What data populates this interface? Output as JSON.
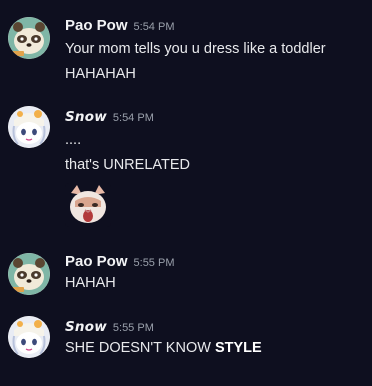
{
  "messages": [
    {
      "author": "Pao Pow",
      "time": "5:54 PM",
      "avatar": "raccoon-avatar-icon",
      "lines": [
        "Your mom tells you u dress like a toddler",
        "HAHAHAH"
      ]
    },
    {
      "author": "Snow",
      "time": "5:54 PM",
      "avatar": "snow-character-avatar-icon",
      "lines": [
        "....",
        "that's UNRELATED"
      ],
      "sticker": "shocked-cat-sticker"
    },
    {
      "author": "Pao Pow",
      "time": "5:55 PM",
      "avatar": "raccoon-avatar-icon",
      "lines": [
        "HAHAH"
      ]
    },
    {
      "author": "Snow",
      "time": "5:55 PM",
      "avatar": "snow-character-avatar-icon",
      "text_prefix": "SHE DOESN'T KNOW ",
      "text_bold": "STYLE"
    }
  ],
  "colors": {
    "background": "#0e0f1f",
    "author": "#f2f3f5",
    "timestamp": "#9aa0ab",
    "text": "#e8e9ec"
  }
}
